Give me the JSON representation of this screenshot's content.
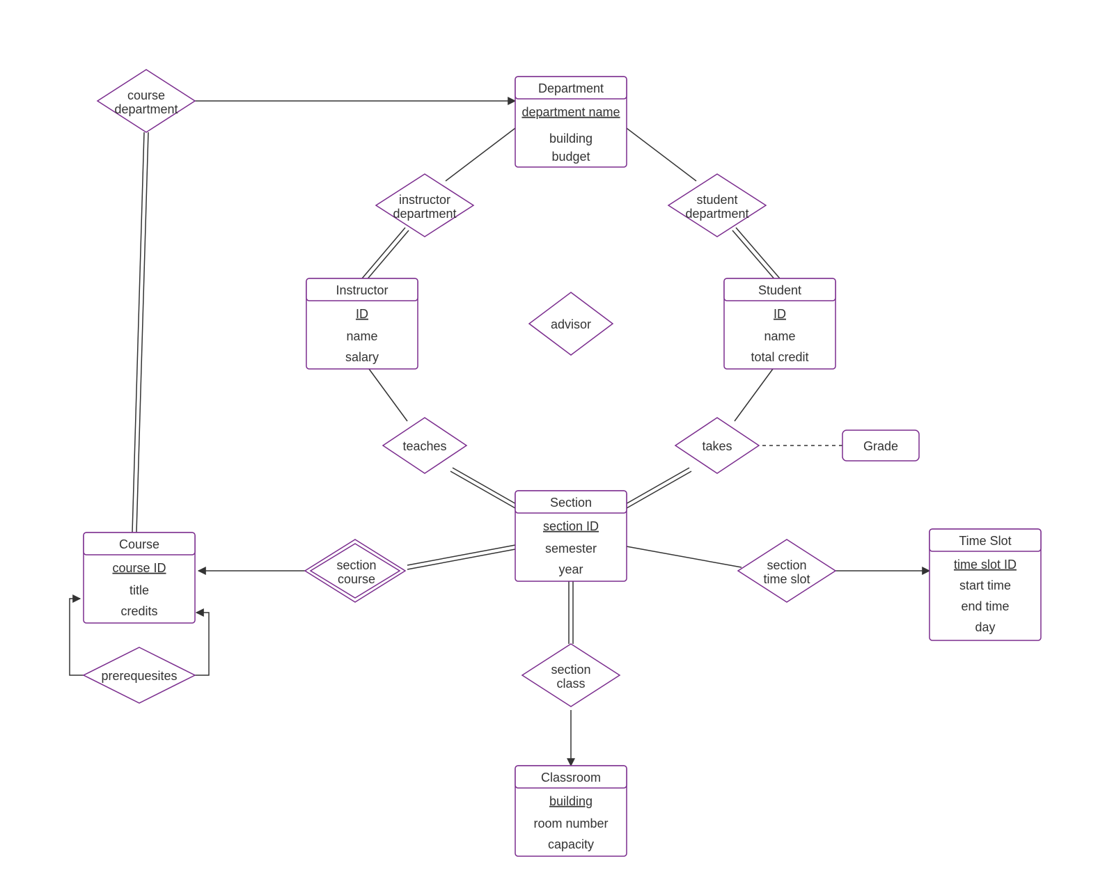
{
  "entities": {
    "department": {
      "title": "Department",
      "key": "department name",
      "attrs": [
        "building",
        "budget"
      ]
    },
    "instructor": {
      "title": "Instructor",
      "key": "ID",
      "attrs": [
        "name",
        "salary"
      ]
    },
    "student": {
      "title": "Student",
      "key": "ID",
      "attrs": [
        "name",
        "total credit"
      ]
    },
    "section": {
      "title": "Section",
      "key": "section ID",
      "attrs": [
        "semester",
        "year"
      ]
    },
    "course": {
      "title": "Course",
      "key": "course ID",
      "attrs": [
        "title",
        "credits"
      ]
    },
    "classroom": {
      "title": "Classroom",
      "key": "building",
      "attrs": [
        "room number",
        "capacity"
      ]
    },
    "timeslot": {
      "title": "Time Slot",
      "key": "time slot ID",
      "attrs": [
        "start time",
        "end time",
        "day"
      ]
    }
  },
  "relationships": {
    "course_department": {
      "line1": "course",
      "line2": "department"
    },
    "instructor_department": {
      "line1": "instructor",
      "line2": "department"
    },
    "student_department": {
      "line1": "student",
      "line2": "department"
    },
    "advisor": {
      "line1": "advisor"
    },
    "teaches": {
      "line1": "teaches"
    },
    "takes": {
      "line1": "takes"
    },
    "section_course": {
      "line1": "section",
      "line2": "course"
    },
    "section_class": {
      "line1": "section",
      "line2": "class"
    },
    "section_timeslot": {
      "line1": "section",
      "line2": "time slot"
    },
    "prerequisites": {
      "line1": "prerequesites"
    }
  },
  "attribute_box": {
    "grade": "Grade"
  }
}
